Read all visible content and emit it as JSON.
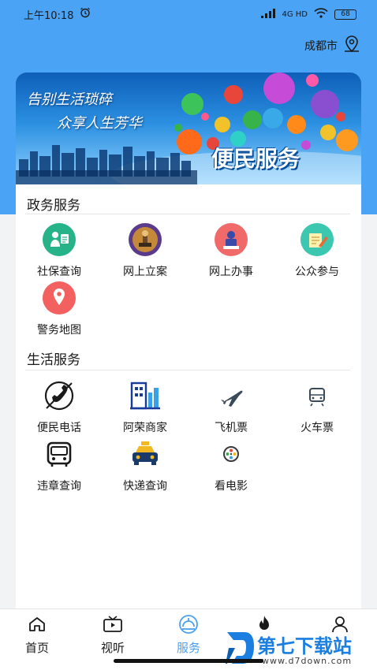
{
  "status_bar": {
    "time": "上午10:18",
    "signal_text": "4G HD",
    "battery": "68"
  },
  "header": {
    "city": "成都市"
  },
  "banner": {
    "slogan_line1": "告别生活琐碎",
    "slogan_line2": "众享人生芳华",
    "title": "便民服务"
  },
  "gov_services": {
    "title": "政务服务",
    "items": [
      {
        "label": "社保查询",
        "icon": "social-security-icon"
      },
      {
        "label": "网上立案",
        "icon": "online-filing-icon"
      },
      {
        "label": "网上办事",
        "icon": "online-affairs-icon"
      },
      {
        "label": "公众参与",
        "icon": "public-participation-icon"
      },
      {
        "label": "警务地图",
        "icon": "police-map-icon"
      }
    ]
  },
  "life_services": {
    "title": "生活服务",
    "items": [
      {
        "label": "便民电话",
        "icon": "phone-icon"
      },
      {
        "label": "阿荣商家",
        "icon": "building-icon"
      },
      {
        "label": "飞机票",
        "icon": "airplane-icon"
      },
      {
        "label": "火车票",
        "icon": "train-icon"
      },
      {
        "label": "违章查询",
        "icon": "bus-icon"
      },
      {
        "label": "快递查询",
        "icon": "taxi-icon"
      },
      {
        "label": "看电影",
        "icon": "film-reel-icon"
      }
    ]
  },
  "tab_bar": {
    "tabs": [
      {
        "label": "首页",
        "icon": "home-icon",
        "active": false
      },
      {
        "label": "视听",
        "icon": "tv-icon",
        "active": false
      },
      {
        "label": "服务",
        "icon": "service-icon",
        "active": true
      },
      {
        "label": "报",
        "icon": "fire-icon",
        "active": false
      },
      {
        "label": "",
        "icon": "user-icon",
        "active": false
      }
    ]
  },
  "watermark": {
    "text": "第七下载站",
    "url": "www.d7down.com"
  },
  "colors": {
    "header_blue": "#4aa3f5",
    "active_tab": "#4a9ff0"
  }
}
